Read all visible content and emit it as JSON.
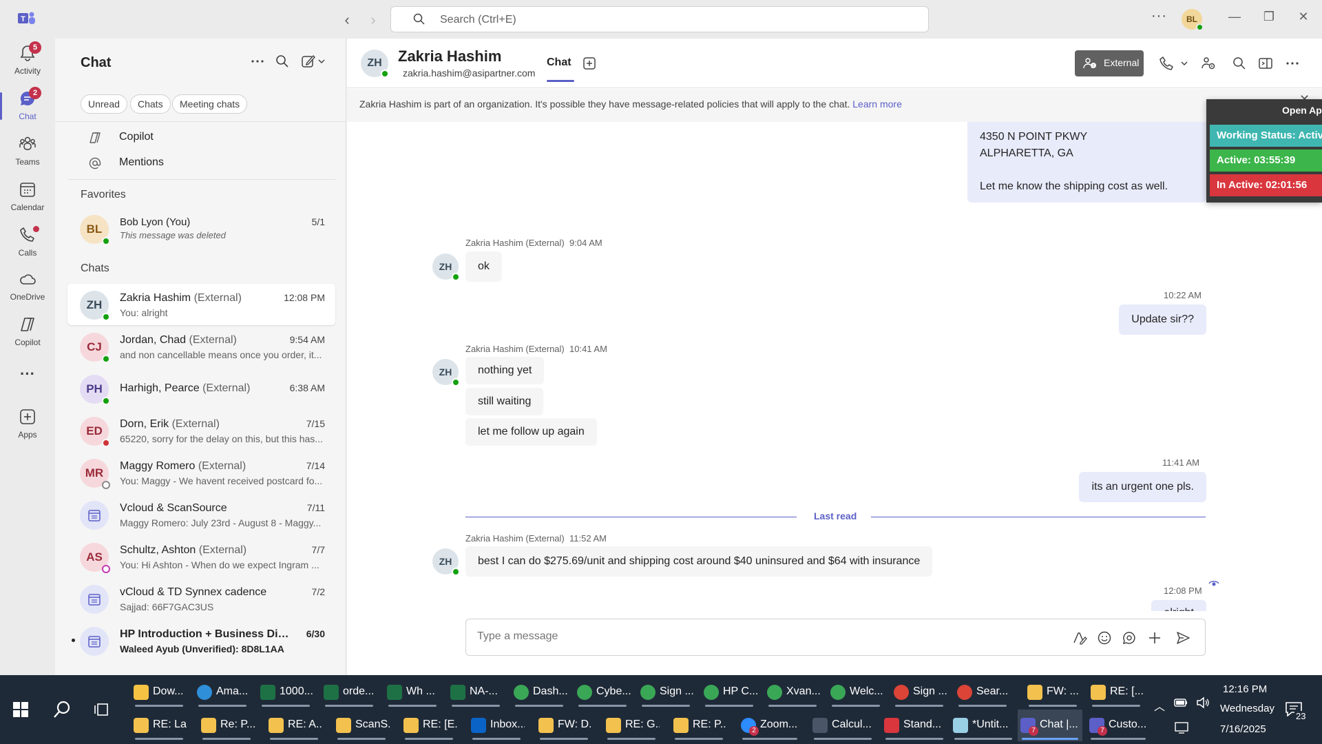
{
  "titlebar": {
    "search_placeholder": "Search (Ctrl+E)",
    "more": "···",
    "me_initials": "BL"
  },
  "rail": [
    {
      "label": "Activity",
      "badge": "5"
    },
    {
      "label": "Chat",
      "badge": "2"
    },
    {
      "label": "Teams"
    },
    {
      "label": "Calendar"
    },
    {
      "label": "Calls"
    },
    {
      "label": "OneDrive"
    },
    {
      "label": "Copilot"
    },
    {
      "label": "···"
    },
    {
      "label": "Apps"
    }
  ],
  "list": {
    "title": "Chat",
    "filters": [
      "Unread",
      "Chats",
      "Meeting chats"
    ],
    "special": [
      "Copilot",
      "Mentions"
    ],
    "favorites_label": "Favorites",
    "chats_label": "Chats",
    "favorites": [
      {
        "initials": "BL",
        "name": "Bob Lyon (You)",
        "preview": "This message was deleted",
        "time": "5/1"
      }
    ],
    "chats": [
      {
        "initials": "ZH",
        "name": "Zakria Hashim",
        "ext": " (External)",
        "preview": "You: alright",
        "time": "12:08 PM"
      },
      {
        "initials": "CJ",
        "name": "Jordan, Chad",
        "ext": " (External)",
        "preview": "and non cancellable means once you order, it...",
        "time": "9:54 AM"
      },
      {
        "initials": "PH",
        "name": "Harhigh, Pearce",
        "ext": " (External)",
        "preview": "",
        "time": "6:38 AM"
      },
      {
        "initials": "ED",
        "name": "Dorn, Erik",
        "ext": " (External)",
        "preview": "65220, sorry for the delay on this, but this has...",
        "time": "7/15"
      },
      {
        "initials": "MR",
        "name": "Maggy Romero",
        "ext": " (External)",
        "preview": "You: Maggy - We havent received postcard fo...",
        "time": "7/14"
      },
      {
        "initials": "",
        "name": "Vcloud & ScanSource",
        "ext": "",
        "preview": "Maggy Romero: July 23rd - August 8 - Maggy...",
        "time": "7/11"
      },
      {
        "initials": "AS",
        "name": "Schultz, Ashton",
        "ext": " (External)",
        "preview": "You: Hi Ashton - When do we expect Ingram ...",
        "time": "7/7"
      },
      {
        "initials": "",
        "name": "vCloud & TD Synnex cadence",
        "ext": "",
        "preview": "Sajjad: 66F7GAC3US",
        "time": "7/2"
      },
      {
        "initials": "",
        "name": "HP Introduction + Business Dis...",
        "ext": "",
        "preview": "Waleed Ayub (Unverified): 8D8L1AA",
        "time": "6/30"
      }
    ]
  },
  "conversation": {
    "initials": "ZH",
    "name": "Zakria Hashim",
    "email": "zakria.hashim@asipartner.com",
    "tab": "Chat",
    "external_label": "External",
    "banner_text": "Zakria Hashim is part of an organization. It's possible they have message-related policies that will apply to the chat. ",
    "banner_link": "Learn more",
    "address_lines": [
      "4350 N POINT PKWY",
      "ALPHARETTA, GA",
      "",
      "Let me know the shipping cost as well."
    ],
    "messages": [
      {
        "sender": "Zakria Hashim (External)",
        "time": "9:04 AM",
        "texts": [
          "ok"
        ]
      },
      {
        "time": "10:22 AM",
        "texts": [
          "Update sir??"
        ]
      },
      {
        "sender": "Zakria Hashim (External)",
        "time": "10:41 AM",
        "texts": [
          "nothing yet",
          "still waiting",
          "let me follow up again"
        ]
      },
      {
        "time": "11:41 AM",
        "texts": [
          "its an urgent one pls."
        ]
      },
      {
        "sender": "Zakria Hashim (External)",
        "time": "11:52 AM",
        "texts": [
          "best I can do $275.69/unit and shipping cost around $40 uninsured and $64 with insurance"
        ]
      },
      {
        "time": "12:08 PM",
        "texts": [
          "alright"
        ]
      }
    ],
    "last_read": "Last read",
    "compose_placeholder": "Type a message"
  },
  "widget": {
    "open_label": "Open Ap",
    "status": "Working Status: Active",
    "active": "Active: 03:55:39",
    "inactive": "In Active: 02:01:56",
    "colors": {
      "status": "#3fb6b0",
      "active": "#3cb54a",
      "inactive": "#d9363e"
    }
  },
  "taskbar": {
    "row1": [
      "Dow...",
      "Ama...",
      "1000...",
      "orde...",
      "Wh ...",
      "NA-...",
      "Dash...",
      "Cybe...",
      "Sign ...",
      "HP C...",
      "Xvan...",
      "Welc...",
      "Sign ...",
      "Sear...",
      "FW: ...",
      "RE: [..."
    ],
    "row2": [
      "RE: La...",
      "Re: P...",
      "RE: A...",
      "ScanS...",
      "RE: [E...",
      "Inbox...",
      "FW: D...",
      "RE: G...",
      "RE: P...",
      "Zoom...",
      "Calcul...",
      "Stand...",
      "*Untit...",
      "Chat |...",
      "Custo..."
    ],
    "time": "12:16 PM",
    "day": "Wednesday",
    "date": "7/16/2025",
    "notifications": "23",
    "zoom_badge": "2",
    "teams_badge": "7"
  }
}
